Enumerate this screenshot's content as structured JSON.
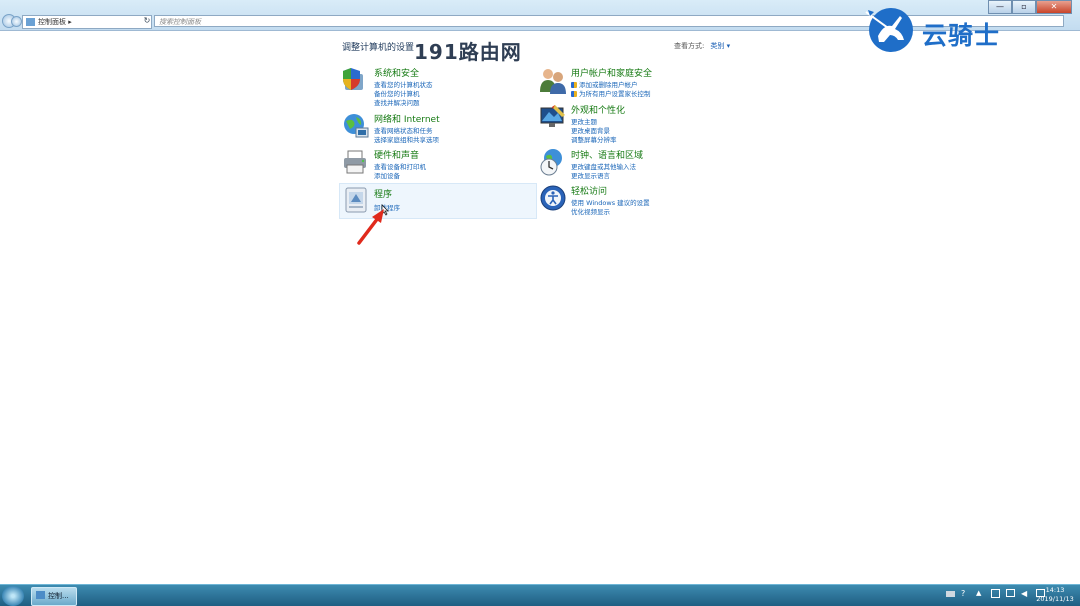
{
  "window": {
    "breadcrumb": "控制面板",
    "search_placeholder": "搜索控制面板",
    "minimize": "—",
    "maximize": "▫",
    "close": "✕"
  },
  "main": {
    "heading": "调整计算机的设置",
    "view_by_label": "查看方式:",
    "view_by_value": "类别"
  },
  "categories_left": [
    {
      "title": "系统和安全",
      "links": [
        "查看您的计算机状态",
        "备份您的计算机",
        "查找并解决问题"
      ]
    },
    {
      "title": "网络和 Internet",
      "links": [
        "查看网络状态和任务",
        "选择家庭组和共享选项"
      ]
    },
    {
      "title": "硬件和声音",
      "links": [
        "查看设备和打印机",
        "添加设备"
      ]
    },
    {
      "title": "程序",
      "links": [
        "卸载程序"
      ]
    }
  ],
  "categories_right": [
    {
      "title": "用户帐户和家庭安全",
      "links": [
        "添加或删除用户帐户",
        "为所有用户设置家长控制"
      ]
    },
    {
      "title": "外观和个性化",
      "links": [
        "更改主题",
        "更改桌面背景",
        "调整屏幕分辨率"
      ]
    },
    {
      "title": "时钟、语言和区域",
      "links": [
        "更改键盘或其他输入法",
        "更改显示语言"
      ]
    },
    {
      "title": "轻松访问",
      "links": [
        "使用 Windows 建议的设置",
        "优化视频显示"
      ]
    }
  ],
  "watermark": {
    "site": "191路由网",
    "brand": "云骑士"
  },
  "taskbar": {
    "task_label": "控制...",
    "time": "14:13",
    "date": "2019/11/13"
  },
  "colors": {
    "title_green": "#167a13",
    "link_blue": "#1a66b8",
    "arrow_red": "#e02a1c",
    "brand_blue": "#1f6ec8"
  }
}
